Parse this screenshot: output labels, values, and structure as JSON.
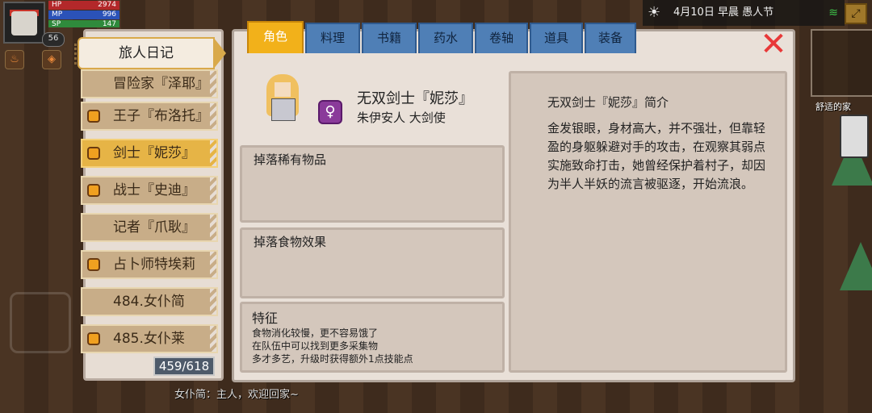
{
  "hud": {
    "level": "56",
    "hp_label": "HP",
    "hp_value": "2974",
    "mp_label": "MP",
    "mp_value": "996",
    "sp_label": "SP",
    "sp_value": "147"
  },
  "status_bar": {
    "date": "4月10日",
    "time_of_day": "早晨",
    "holiday": "愚人节"
  },
  "map": {
    "location_label": "舒适的家"
  },
  "chat": {
    "message": "女仆简：主人，欢迎回家~"
  },
  "journal": {
    "title": "旅人日记",
    "items": [
      {
        "label": "冒险家『泽耶』",
        "coin": false,
        "selected": false
      },
      {
        "label": "王子『布洛托』",
        "coin": true,
        "selected": false
      },
      {
        "label": "剑士『妮莎』",
        "coin": true,
        "selected": true
      },
      {
        "label": "战士『史迪』",
        "coin": true,
        "selected": false
      },
      {
        "label": "记者『爪耿』",
        "coin": false,
        "selected": false
      },
      {
        "label": "占卜师特埃莉",
        "coin": true,
        "selected": false
      },
      {
        "label": "484.女仆简",
        "coin": false,
        "selected": false
      },
      {
        "label": "485.女仆莱",
        "coin": true,
        "selected": false
      }
    ],
    "counter": "459/618"
  },
  "tabs": [
    "角色",
    "料理",
    "书籍",
    "药水",
    "卷轴",
    "道具",
    "装备"
  ],
  "active_tab": "角色",
  "character": {
    "name": "无双剑士『妮莎』",
    "subtitle": "朱伊安人 大剑使",
    "gender_symbol": "♀",
    "rare_drops_label": "掉落稀有物品",
    "food_effect_label": "掉落食物效果",
    "traits_label": "特征",
    "traits": [
      "食物消化较慢，更不容易饿了",
      "在队伍中可以找到更多采集物",
      "多才多艺，升级时获得额外1点技能点"
    ],
    "intro_title": "无双剑士『妮莎』简介",
    "intro_text": "金发银眼，身材高大，并不强壮，但靠轻盈的身躯躲避对手的攻击，在观察其弱点实施致命打击，她曾经保护着村子，却因为半人半妖的流言被驱逐，开始流浪。"
  },
  "colors": {
    "tab_active": "#f2b11a",
    "tab_inactive": "#4f7fb6",
    "item_selected": "#e6b446",
    "close": "#e83838"
  }
}
